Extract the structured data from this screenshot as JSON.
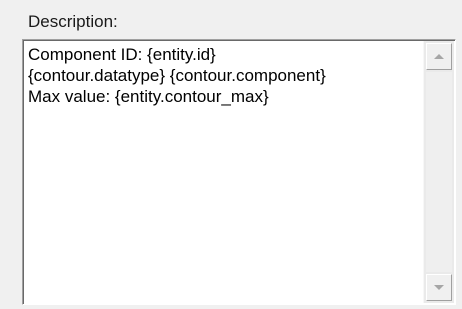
{
  "description": {
    "label": "Description:",
    "lines": [
      "Component ID: {entity.id}",
      "{contour.datatype} {contour.component}",
      "Max value: {entity.contour_max}"
    ]
  },
  "icons": {
    "scroll_up": "triangle-up-icon",
    "scroll_down": "triangle-down-icon"
  },
  "colors": {
    "background": "#f0f0f0",
    "field": "#ffffff",
    "arrow": "#a6a6a6"
  }
}
